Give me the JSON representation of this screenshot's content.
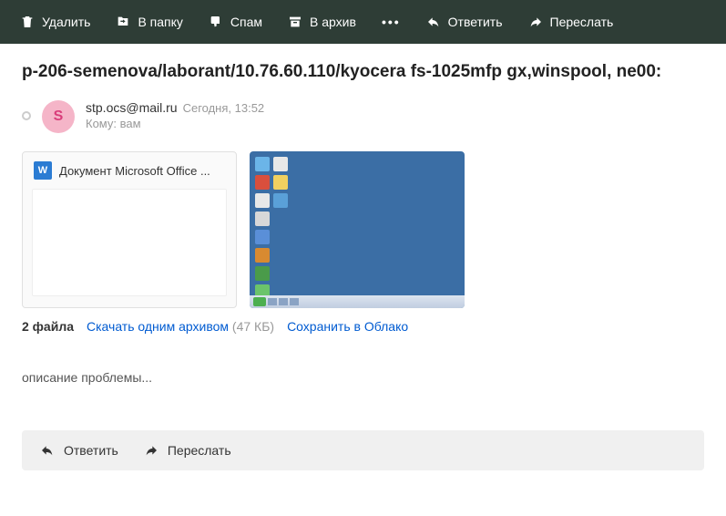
{
  "toolbar": {
    "delete": "Удалить",
    "to_folder": "В папку",
    "spam": "Спам",
    "archive": "В архив",
    "more": "•••",
    "reply": "Ответить",
    "forward": "Переслать"
  },
  "subject": "p-206-semenova/laborant/10.76.60.110/kyocera fs-1025mfp gx,winspool, ne00:",
  "sender": {
    "initial": "S",
    "email": "stp.ocs@mail.ru",
    "date": "Сегодня, 13:52",
    "recipient_label": "Кому:",
    "recipient_value": "вам"
  },
  "attachments": {
    "doc_icon_letter": "W",
    "doc_name": "Документ Microsoft Office ...",
    "count_label": "2 файла",
    "download_label": "Скачать одним архивом",
    "size": "(47 КБ)",
    "save_cloud": "Сохранить в Облако"
  },
  "body": "описание проблемы...",
  "footer": {
    "reply": "Ответить",
    "forward": "Переслать"
  }
}
